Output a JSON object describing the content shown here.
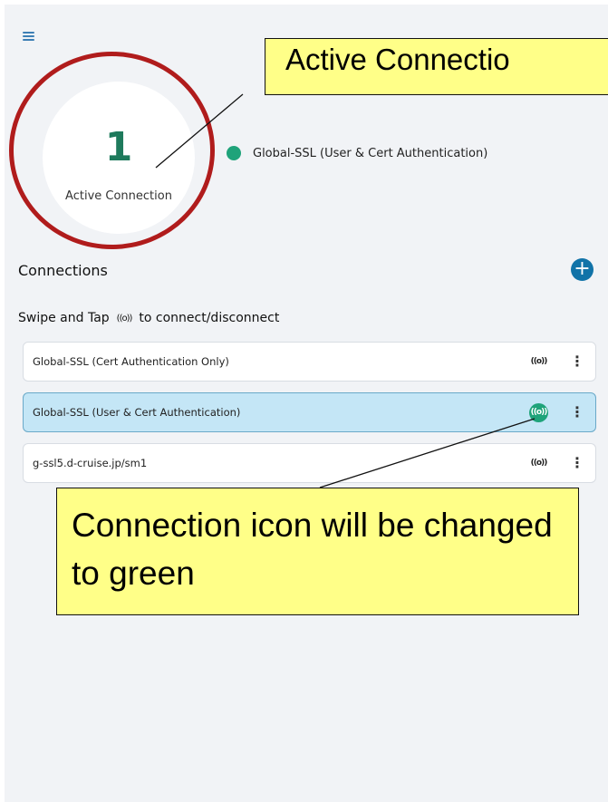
{
  "header": {
    "menu_icon": "hamburger-menu-icon"
  },
  "stats": {
    "active_count": "1",
    "active_label": "Active Connection"
  },
  "active_connections": [
    {
      "name": "Global-SSL (User & Cert Authentication)",
      "status_color": "#1fa37a"
    }
  ],
  "connections": {
    "title": "Connections",
    "add_icon": "+",
    "hint_prefix": "Swipe and Tap",
    "hint_icon": "((o))",
    "hint_suffix": "to connect/disconnect",
    "items": [
      {
        "label": "Global-SSL (Cert Authentication Only)",
        "icon": "((o))",
        "more": "⋮",
        "selected": false
      },
      {
        "label": "Global-SSL (User & Cert Authentication)",
        "icon": "((o))",
        "more": "⋮",
        "selected": true
      },
      {
        "label": "g-ssl5.d-cruise.jp/sm1",
        "icon": "((o))",
        "more": "⋮",
        "selected": false
      }
    ]
  },
  "annotations": {
    "top_callout": "Active Connectio",
    "bottom_callout": "Connection icon will be changed to green",
    "highlight_color": "#b01c1c",
    "callout_color": "#ffff88"
  },
  "colors": {
    "connected": "#1fa37a",
    "accent": "#1173a8",
    "selected_row": "#c4e6f6"
  }
}
